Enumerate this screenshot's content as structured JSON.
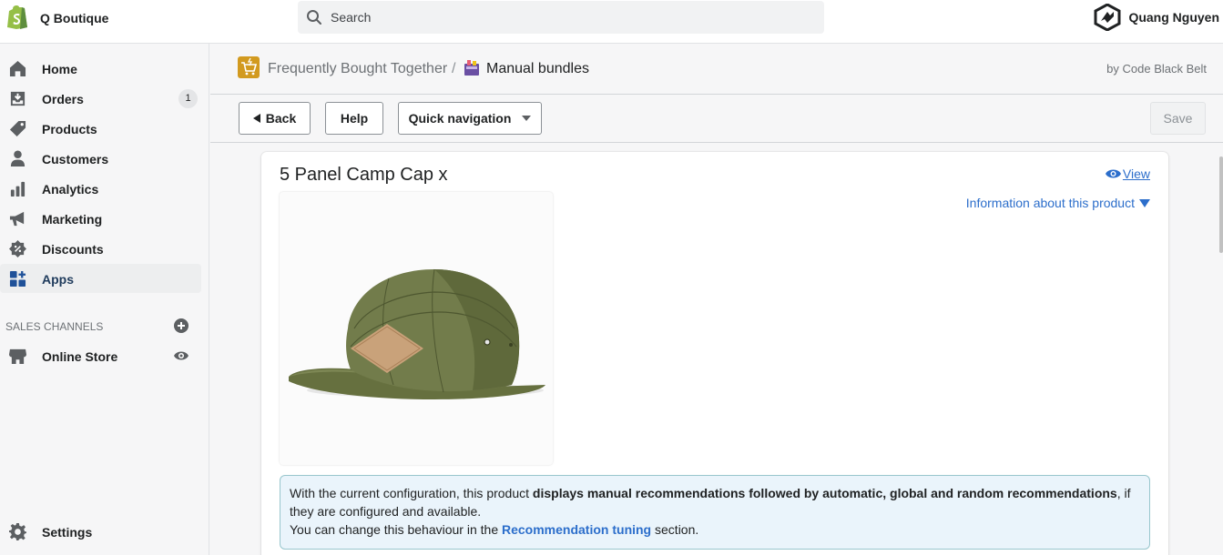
{
  "topbar": {
    "shop_name": "Q Boutique",
    "search_placeholder": "Search",
    "user_name": "Quang Nguyen"
  },
  "sidebar": {
    "items": [
      {
        "label": "Home",
        "icon": "home-icon"
      },
      {
        "label": "Orders",
        "icon": "orders-icon",
        "badge": "1"
      },
      {
        "label": "Products",
        "icon": "tag-icon"
      },
      {
        "label": "Customers",
        "icon": "person-icon"
      },
      {
        "label": "Analytics",
        "icon": "bar-chart-icon"
      },
      {
        "label": "Marketing",
        "icon": "megaphone-icon"
      },
      {
        "label": "Discounts",
        "icon": "discount-icon"
      },
      {
        "label": "Apps",
        "icon": "apps-icon",
        "active": true
      }
    ],
    "sales_channels_title": "SALES CHANNELS",
    "online_store": "Online Store",
    "settings": "Settings"
  },
  "app_header": {
    "crumb_app": "Frequently Bought Together",
    "separator": "/",
    "crumb_page": "Manual bundles",
    "by_text": "by Code Black Belt"
  },
  "toolbar": {
    "back_label": "Back",
    "help_label": "Help",
    "quick_nav_label": "Quick navigation",
    "save_label": "Save"
  },
  "product": {
    "title": "5 Panel Camp Cap x",
    "view_label": "View",
    "info_label": "Information about this product"
  },
  "banner": {
    "text_1": "With the current configuration, this product ",
    "text_bold": "displays manual recommendations followed by automatic, global and random recommendations",
    "text_2": ", if they are configured and available.",
    "text_3": "You can change this behaviour in the ",
    "link_label": "Recommendation tuning",
    "text_4": " section."
  },
  "colors": {
    "accent_link": "#2c6ecb",
    "shopify_green": "#95bf47",
    "banner_bg": "#eaf4fb",
    "banner_border": "#98c6cd"
  }
}
